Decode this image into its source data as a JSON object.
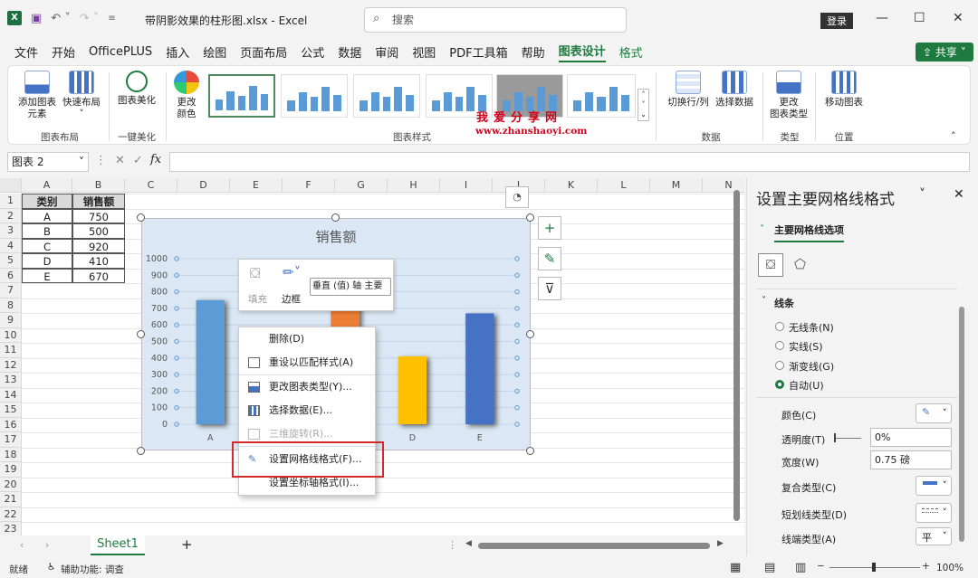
{
  "window": {
    "doc_title": "带阴影效果的柱形图.xlsx - Excel",
    "search_placeholder": "搜索",
    "login_label": "登录",
    "share_label": "共享"
  },
  "menu": {
    "items": [
      "文件",
      "开始",
      "OfficePLUS",
      "插入",
      "绘图",
      "页面布局",
      "公式",
      "数据",
      "审阅",
      "视图",
      "PDF工具箱",
      "帮助"
    ],
    "active": "图表设计",
    "format": "格式"
  },
  "ribbon": {
    "add_element_1": "添加图表",
    "add_element_2": "元素",
    "quick_layout": "快速布局",
    "beautify": "图表美化",
    "change_color_1": "更改",
    "change_color_2": "颜色",
    "switch_rowcol": "切换行/列",
    "select_data": "选择数据",
    "change_type_1": "更改",
    "change_type_2": "图表类型",
    "move_chart": "移动图表",
    "group_layout": "图表布局",
    "group_beautify": "一键美化",
    "group_styles": "图表样式",
    "group_data": "数据",
    "group_type": "类型",
    "group_location": "位置",
    "watermark_1": "我爱分享网",
    "watermark_2": "www.zhanshaoyi.com"
  },
  "formula_bar": {
    "name_box": "图表 2",
    "fx": "fx"
  },
  "grid": {
    "columns": [
      "A",
      "B",
      "C",
      "D",
      "E",
      "F",
      "G",
      "H",
      "I",
      "J",
      "K",
      "L",
      "M",
      "N"
    ],
    "rows": [
      "1",
      "2",
      "3",
      "4",
      "5",
      "6",
      "7",
      "8",
      "9",
      "10",
      "11",
      "12",
      "13",
      "14",
      "15",
      "16",
      "17",
      "18",
      "19",
      "20",
      "21",
      "22",
      "23"
    ],
    "table_header": [
      "类别",
      "销售额"
    ],
    "table_rows": [
      [
        "A",
        "750"
      ],
      [
        "B",
        "500"
      ],
      [
        "C",
        "920"
      ],
      [
        "D",
        "410"
      ],
      [
        "E",
        "670"
      ]
    ]
  },
  "chart_data": {
    "type": "bar",
    "title": "销售额",
    "categories": [
      "A",
      "B",
      "C",
      "D",
      "E"
    ],
    "values": [
      750,
      500,
      920,
      410,
      670
    ],
    "colors": [
      "#5b9bd5",
      "#a5a5a5",
      "#ed7d31",
      "#ffc000",
      "#4472c4"
    ],
    "ylim": [
      0,
      1000
    ],
    "yticks": [
      "1000",
      "900",
      "800",
      "700",
      "600",
      "500",
      "400",
      "300",
      "200",
      "100",
      "0"
    ],
    "grid": true
  },
  "mini_toolbar": {
    "fill": "填充",
    "border": "边框",
    "selector": "垂直 (值) 轴 主要"
  },
  "context_menu": {
    "items": [
      "删除(D)",
      "重设以匹配样式(A)",
      "更改图表类型(Y)...",
      "选择数据(E)...",
      "三维旋转(R)...",
      "设置网格线格式(F)...",
      "设置坐标轴格式(I)..."
    ],
    "disabled": "三维旋转(R)..."
  },
  "sheet_tabs": {
    "active": "Sheet1",
    "add": "+"
  },
  "status": {
    "ready": "就绪",
    "accessibility": "辅助功能: 调查",
    "zoom": "100%"
  },
  "pane": {
    "title": "设置主要网格线格式",
    "section": "主要网格线选项",
    "line_header": "线条",
    "options": [
      "无线条(N)",
      "实线(S)",
      "渐变线(G)",
      "自动(U)"
    ],
    "selected_option": "自动(U)",
    "color": "颜色(C)",
    "transparency": "透明度(T)",
    "transparency_value": "0%",
    "width": "宽度(W)",
    "width_value": "0.75 磅",
    "compound": "复合类型(C)",
    "dash": "短划线类型(D)",
    "cap": "线端类型(A)",
    "cap_value": "平"
  }
}
